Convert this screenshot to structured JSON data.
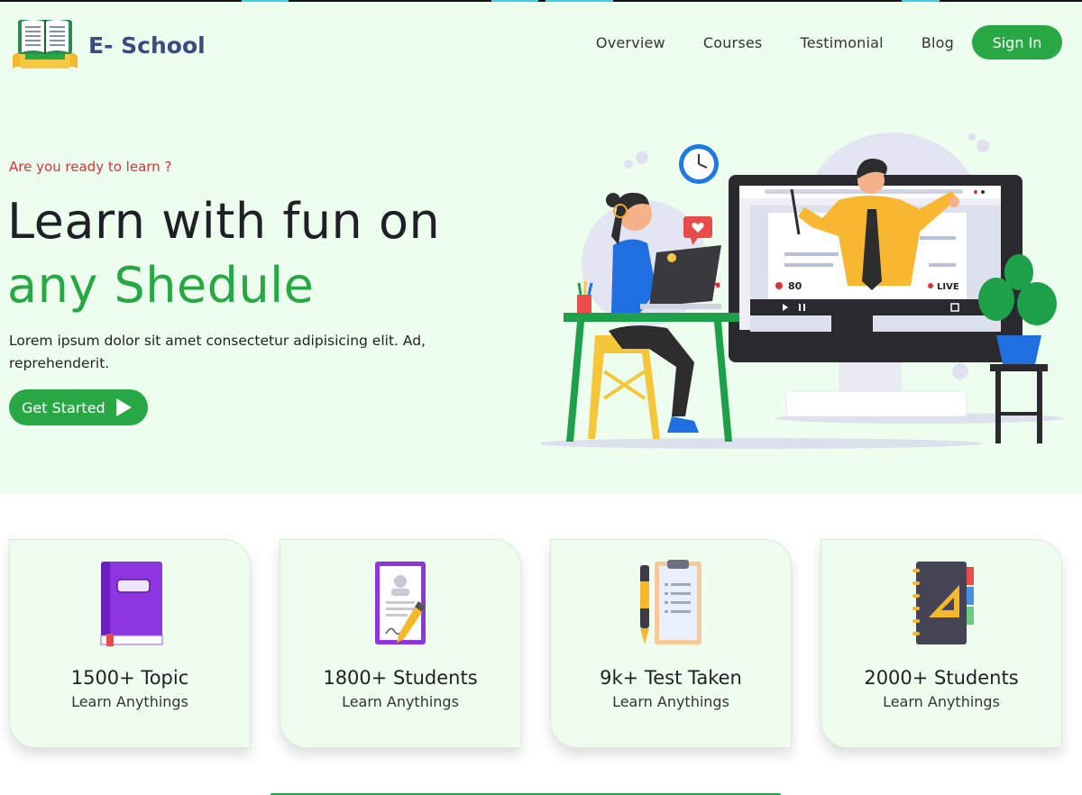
{
  "brand": {
    "name": "E- School"
  },
  "nav": {
    "items": [
      "Overview",
      "Courses",
      "Testimonial",
      "Blog"
    ],
    "signin_label": "Sign In"
  },
  "hero": {
    "eyebrow": "Are you ready to learn ?",
    "heading_line1": "Learn with fun on",
    "heading_line2": "any Shedule",
    "description": "Lorem ipsum dolor sit amet consectetur adipisicing elit. Ad, reprehenderit.",
    "cta_label": "Get Started",
    "illustration": {
      "viewer_count": "80",
      "live_label": "LIVE"
    }
  },
  "stats": [
    {
      "icon": "book-icon",
      "title": "1500+ Topic",
      "subtitle": "Learn Anythings"
    },
    {
      "icon": "certificate-pen-icon",
      "title": "1800+ Students",
      "subtitle": "Learn Anythings"
    },
    {
      "icon": "clipboard-pen-icon",
      "title": "9k+ Test Taken",
      "subtitle": "Learn Anythings"
    },
    {
      "icon": "notebook-ruler-icon",
      "title": "2000+ Students",
      "subtitle": "Learn Anythings"
    }
  ],
  "colors": {
    "primary": "#27a844",
    "hero_bg": "#edfdee",
    "brand_text": "#3b4b7e",
    "accent_red": "#d9343a"
  }
}
